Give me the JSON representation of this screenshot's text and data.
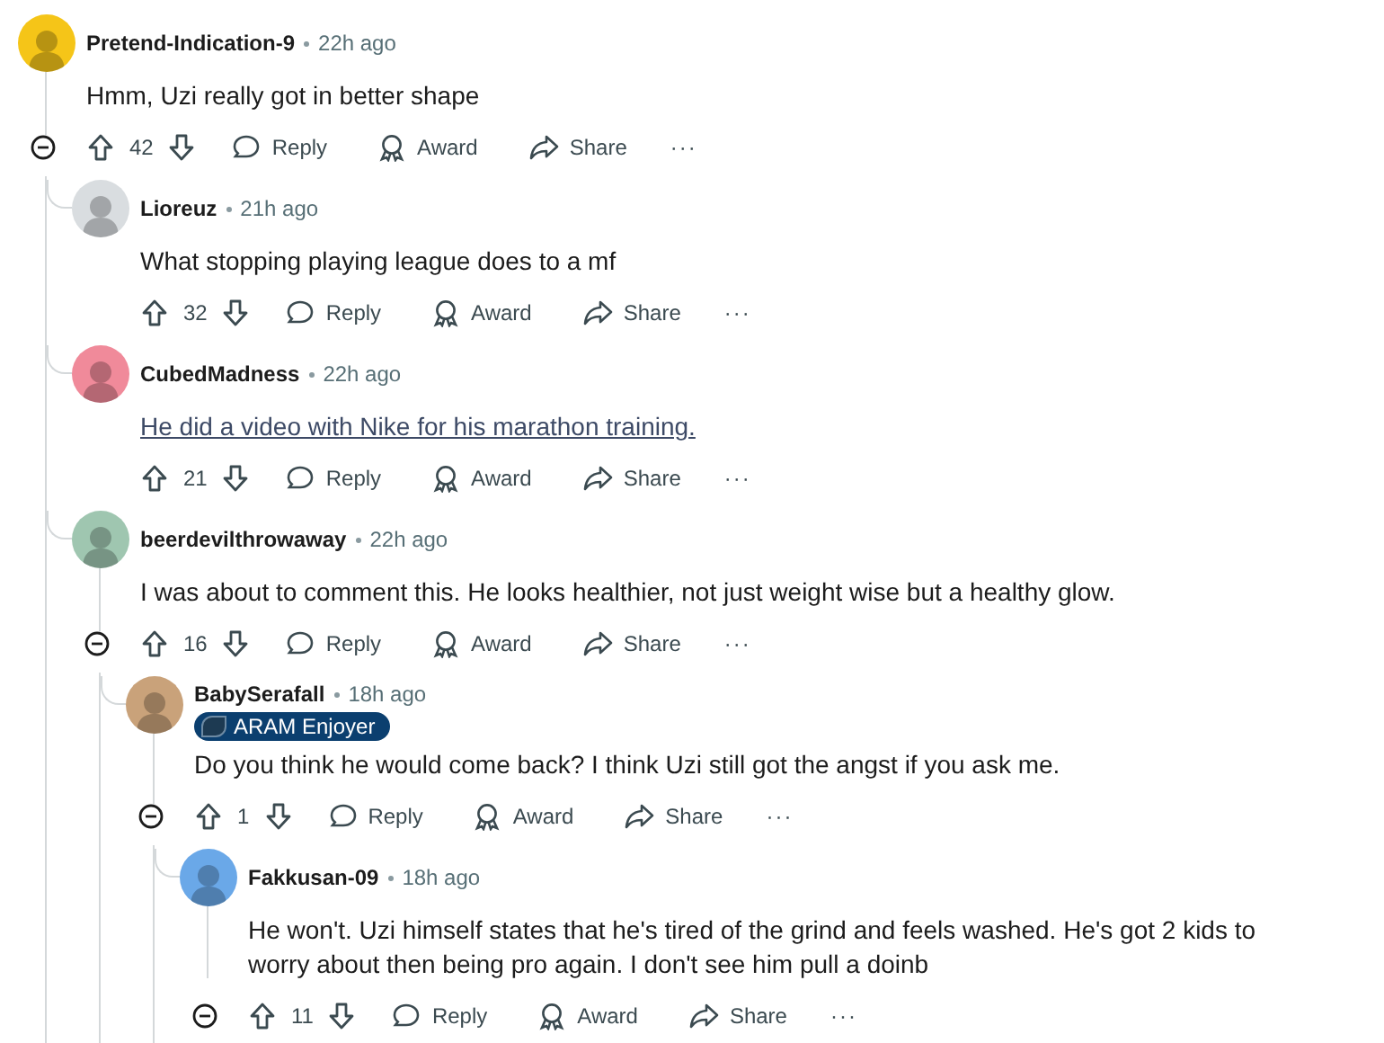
{
  "comments": [
    {
      "author": "Pretend-Indication-9",
      "time": "22h ago",
      "body": "Hmm, Uzi really got in better shape",
      "link": false,
      "score": "42",
      "expanded": true,
      "actions": [
        {
          "kind": "reply",
          "label": "Reply"
        },
        {
          "kind": "award",
          "label": "Award"
        },
        {
          "kind": "share",
          "label": "Share"
        },
        {
          "kind": "more",
          "label": "···"
        }
      ],
      "children": [
        {
          "author": "Lioreuz",
          "time": "21h ago",
          "body": "What stopping playing league does to a mf",
          "link": false,
          "score": "32",
          "actions": [
            {
              "kind": "reply",
              "label": "Reply"
            },
            {
              "kind": "award",
              "label": "Award"
            },
            {
              "kind": "share",
              "label": "Share"
            },
            {
              "kind": "more",
              "label": "···"
            }
          ]
        },
        {
          "author": "CubedMadness",
          "time": "22h ago",
          "body": "He did a video with Nike for his marathon training.",
          "link": true,
          "score": "21",
          "actions": [
            {
              "kind": "reply",
              "label": "Reply"
            },
            {
              "kind": "award",
              "label": "Award"
            },
            {
              "kind": "share",
              "label": "Share"
            },
            {
              "kind": "more",
              "label": "···"
            }
          ]
        },
        {
          "author": "beerdevilthrowaway",
          "time": "22h ago",
          "body": "I was about to comment this. He looks healthier, not just weight wise but a healthy glow.",
          "link": false,
          "score": "16",
          "expanded": true,
          "actions": [
            {
              "kind": "reply",
              "label": "Reply"
            },
            {
              "kind": "award",
              "label": "Award"
            },
            {
              "kind": "share",
              "label": "Share"
            },
            {
              "kind": "more",
              "label": "···"
            }
          ],
          "children": [
            {
              "author": "BabySerafall",
              "time": "18h ago",
              "flair": "ARAM Enjoyer",
              "body": "Do you think he would come back? I think Uzi still got the angst if you ask me.",
              "link": false,
              "score": "1",
              "expanded": true,
              "actions": [
                {
                  "kind": "reply",
                  "label": "Reply"
                },
                {
                  "kind": "award",
                  "label": "Award"
                },
                {
                  "kind": "share",
                  "label": "Share"
                },
                {
                  "kind": "more",
                  "label": "···"
                }
              ],
              "children": [
                {
                  "author": "Fakkusan-09",
                  "time": "18h ago",
                  "body": "He won't. Uzi himself states that he's tired of the grind and feels washed. He's got 2 kids to worry about then being pro again. I don't see him pull a doinb",
                  "link": false,
                  "score": "11",
                  "expanded": true,
                  "actions": [
                    {
                      "kind": "reply",
                      "label": "Reply"
                    },
                    {
                      "kind": "award",
                      "label": "Award"
                    },
                    {
                      "kind": "share",
                      "label": "Share"
                    },
                    {
                      "kind": "more",
                      "label": "···"
                    }
                  ]
                }
              ]
            }
          ]
        }
      ]
    }
  ]
}
